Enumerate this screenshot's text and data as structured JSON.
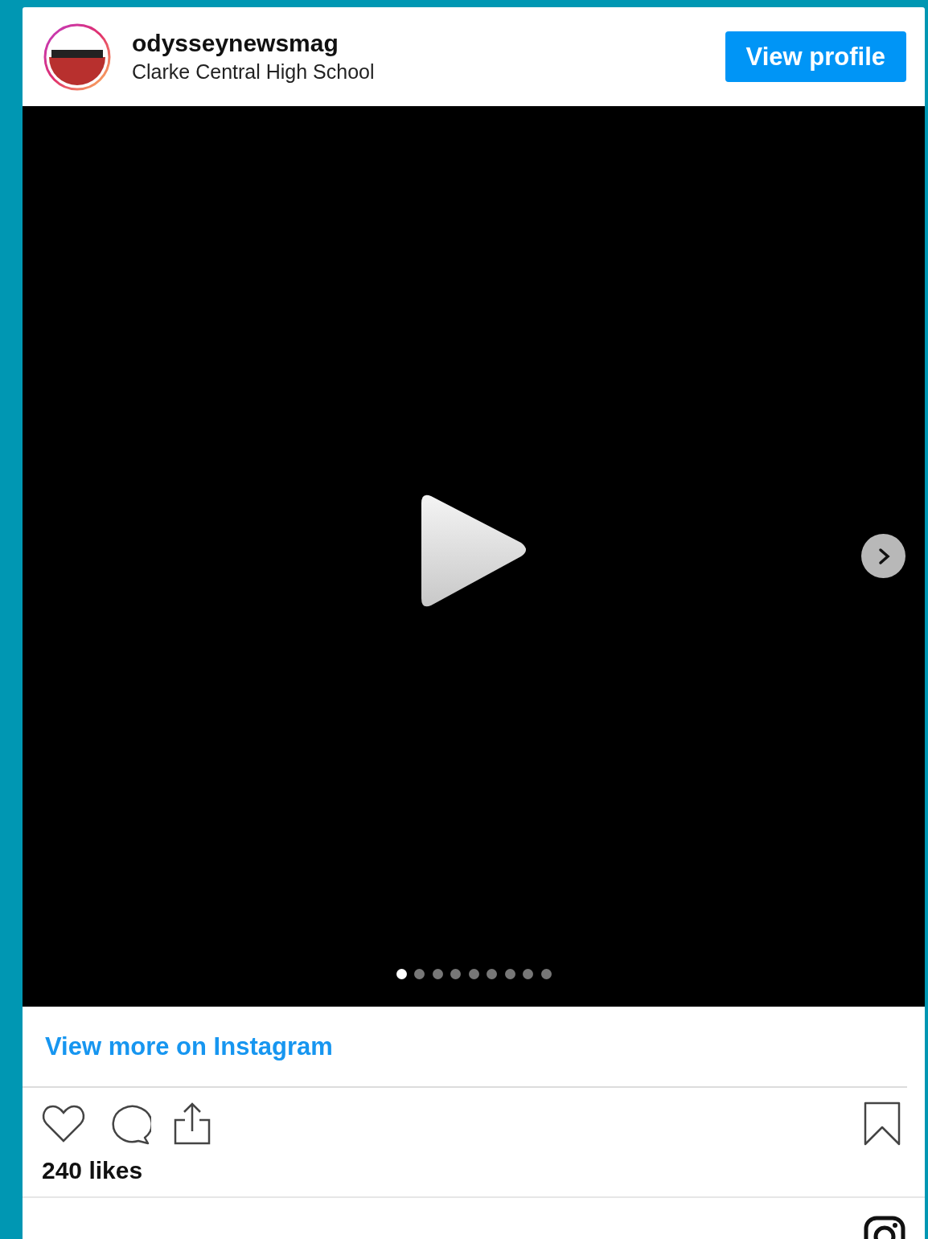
{
  "header": {
    "username": "odysseynewsmag",
    "location": "Clarke Central High School",
    "button": "View profile"
  },
  "media": {
    "slides": [
      {
        "selected": true
      },
      {
        "selected": false
      },
      {
        "selected": false
      },
      {
        "selected": false
      },
      {
        "selected": false
      },
      {
        "selected": false
      },
      {
        "selected": false
      },
      {
        "selected": false
      },
      {
        "selected": false
      }
    ]
  },
  "link": "View more on Instagram",
  "likes": "240 likes"
}
